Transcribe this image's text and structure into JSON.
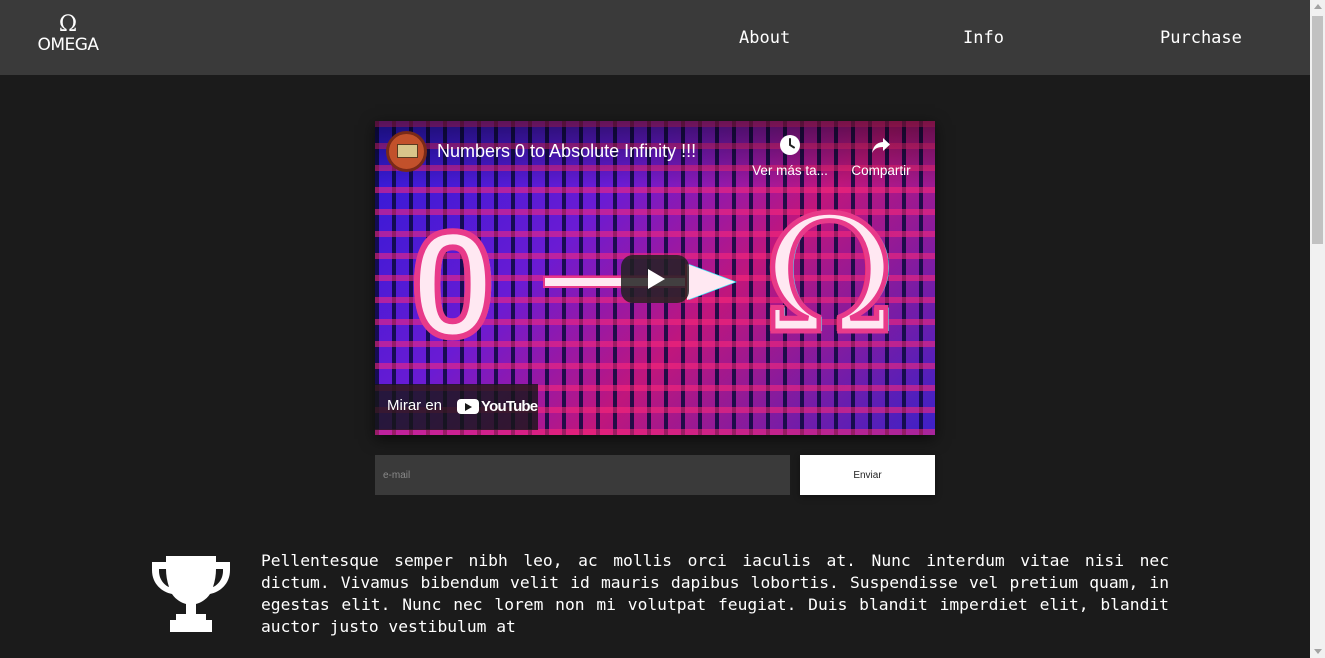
{
  "header": {
    "logo_symbol": "Ω",
    "logo_text": "OMEGA",
    "nav": [
      {
        "label": "About"
      },
      {
        "label": "Info"
      },
      {
        "label": "Purchase"
      }
    ]
  },
  "video": {
    "title": "Numbers 0 to Absolute Infinity !!!",
    "watch_later_label": "Ver más ta...",
    "share_label": "Compartir",
    "watch_on_label": "Mirar en",
    "youtube_label": "YouTube",
    "thumb_zero": "0",
    "thumb_omega": "Ω"
  },
  "form": {
    "email_placeholder": "e-mail",
    "submit_label": "Enviar"
  },
  "feature": {
    "icon": "trophy-icon",
    "text": "Pellentesque semper nibh leo, ac mollis orci iaculis at. Nunc interdum vitae nisi nec dictum. Vivamus bibendum velit id mauris dapibus lobortis. Suspendisse vel pretium quam, in egestas elit. Nunc nec lorem non mi volutpat feugiat. Duis blandit imperdiet elit, blandit auctor justo vestibulum at"
  },
  "colors": {
    "page_background": "#1b1b1b",
    "header_background": "#3a3a3a",
    "input_background": "#3a3a3a",
    "button_background": "#ffffff"
  }
}
